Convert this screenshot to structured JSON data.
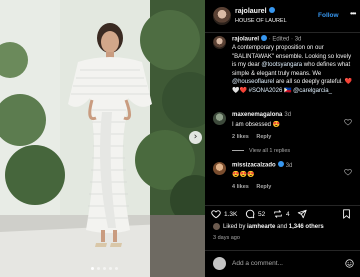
{
  "header": {
    "username": "rajolaurel",
    "subtitle": "HOUSE OF LAUREL",
    "follow_label": "Follow",
    "more_glyph": "•••"
  },
  "caption": {
    "username": "rajolaurel",
    "edited": "Edited",
    "time": "3d",
    "text_1": "A contemporary proposition on our \"BALINTAWAK\" ensemble. Looking so lovely is my dear",
    "mention_1": "@tootsyangara",
    "text_2": " who defines what simple & elegant truly means. We",
    "mention_2": "@houseoflaurel",
    "text_3": " are all so deeply grateful. ",
    "emojis": "❤️🤍❤️",
    "hashtag": "#SONA2026",
    "flag": "🇵🇭",
    "mention_3": "@carelgarcia_"
  },
  "comments": [
    {
      "username": "maxenemagalona",
      "time": "3d",
      "text": "I am obsessed 😍",
      "likes": "2 likes",
      "reply_label": "Reply",
      "view_replies": "View all 1 replies"
    },
    {
      "username": "missizacalzado",
      "time": "3d",
      "text": "😍😍😍",
      "likes": "4 likes",
      "reply_label": "Reply"
    }
  ],
  "actions": {
    "like_count": "1.3K",
    "comment_count": "52",
    "repost_count": "4"
  },
  "liked_by": {
    "prefix": "Liked by ",
    "user": "iamhearte",
    "middle": " and ",
    "others": "1,346 others"
  },
  "posted": "3 days ago",
  "add_comment": {
    "placeholder": "Add a comment..."
  },
  "carousel": {
    "slide_count": 5,
    "active_index": 0
  },
  "icons": {
    "verified": "verified-badge-icon",
    "heart": "heart-icon",
    "comment": "comment-bubble-icon",
    "repost": "repost-icon",
    "share": "send-icon",
    "save": "bookmark-icon",
    "emoji": "emoji-smile-icon",
    "next": "chevron-right-icon"
  },
  "colors": {
    "accent": "#3797f0",
    "background": "#000000",
    "muted": "#a8a8a8"
  }
}
